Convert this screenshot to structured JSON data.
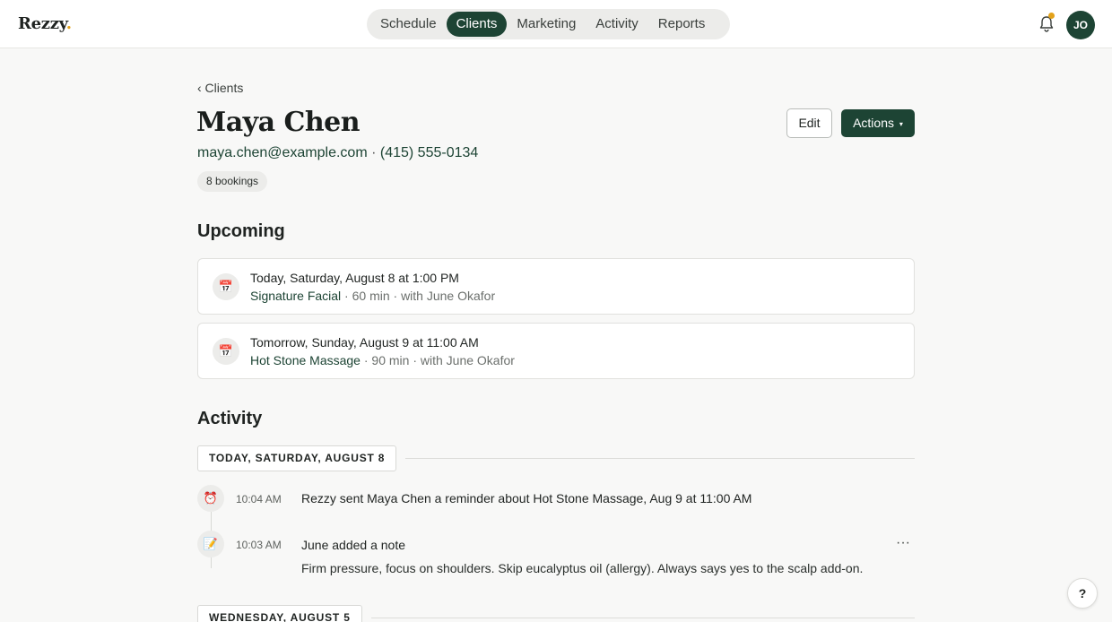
{
  "app": {
    "logo": "Rezzy",
    "logo_dot": "."
  },
  "nav": {
    "tabs": [
      {
        "label": "Schedule",
        "active": false
      },
      {
        "label": "Clients",
        "active": true
      },
      {
        "label": "Marketing",
        "active": false
      },
      {
        "label": "Activity",
        "active": false
      },
      {
        "label": "Reports",
        "active": false
      }
    ]
  },
  "header": {
    "notification_icon": "bell-icon",
    "avatar_initials": "JO"
  },
  "breadcrumb": {
    "back_label": "‹ Clients"
  },
  "client": {
    "name": "Maya Chen",
    "email": "maya.chen@example.com",
    "separator": " · ",
    "phone": "(415) 555-0134",
    "bookings_badge": "8 bookings"
  },
  "actions": {
    "edit_label": "Edit",
    "actions_label": "Actions",
    "actions_caret": "▾"
  },
  "upcoming": {
    "title": "Upcoming",
    "items": [
      {
        "when": "Today, Saturday, August 8 at 1:00 PM",
        "service": "Signature Facial",
        "meta": " · 60 min · with June Okafor",
        "icon": "calendar-icon"
      },
      {
        "when": "Tomorrow, Sunday, August 9 at 11:00 AM",
        "service": "Hot Stone Massage",
        "meta": " · 90 min · with June Okafor",
        "icon": "calendar-icon"
      }
    ]
  },
  "activity": {
    "title": "Activity",
    "groups": [
      {
        "date_label": "TODAY, SATURDAY, AUGUST 8",
        "entries": [
          {
            "time": "10:04 AM",
            "icon": "alarm-clock-icon",
            "text": "Rezzy sent Maya Chen a reminder about Hot Stone Massage, Aug 9 at 11:00 AM"
          },
          {
            "time": "10:03 AM",
            "icon": "memo-icon",
            "text": "June added a note",
            "note": "Firm pressure, focus on shoulders. Skip eucalyptus oil (allergy). Always says yes to the scalp add-on."
          }
        ]
      },
      {
        "date_label": "WEDNESDAY, AUGUST 5"
      }
    ],
    "more_label": "···"
  },
  "help": {
    "label": "?"
  },
  "colors": {
    "brand": "#1d4434",
    "accent": "#e3a21a",
    "background": "#f8f8f7"
  }
}
